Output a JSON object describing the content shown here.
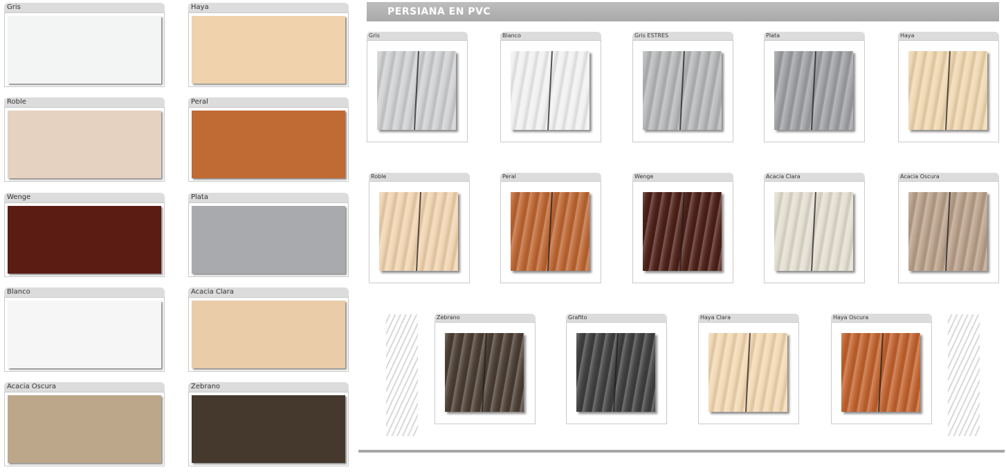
{
  "left_swatches": [
    {
      "label": "Gris",
      "color": "#f3f4f4"
    },
    {
      "label": "Haya",
      "color": "#f0d2ad"
    },
    {
      "label": "Roble",
      "color": "#e5d2c0"
    },
    {
      "label": "Peral",
      "color": "#c06a34"
    },
    {
      "label": "Wenge",
      "color": "#5b1c14"
    },
    {
      "label": "Plata",
      "color": "#a8aaad"
    },
    {
      "label": "Blanco",
      "color": "#f6f6f6"
    },
    {
      "label": "Acacia Clara",
      "color": "#ebcca9"
    },
    {
      "label": "Acacia Oscura",
      "color": "#bda78b"
    },
    {
      "label": "Zebrano",
      "color": "#45392d"
    }
  ],
  "pvc": {
    "title": "PERSIANA EN PVC",
    "swatches": [
      {
        "label": "Gris",
        "color": "#cfd0d2"
      },
      {
        "label": "Blanco",
        "color": "#f1f1f1"
      },
      {
        "label": "Gris ESTRES",
        "color": "#b6b7b8"
      },
      {
        "label": "Plata",
        "color": "#9ea0a3"
      },
      {
        "label": "Haya",
        "color": "#f0d7b0"
      },
      {
        "label": "Roble",
        "color": "#f1d4b0"
      },
      {
        "label": "Peral",
        "color": "#bd6632"
      },
      {
        "label": "Wenge",
        "color": "#4c1f16"
      },
      {
        "label": "Acacia Clara",
        "color": "#e3ded0"
      },
      {
        "label": "Acacia Oscura",
        "color": "#b9a08a"
      },
      {
        "label": "Zebrano",
        "color": "#4a3d33"
      },
      {
        "label": "Grafito",
        "color": "#3f3f40"
      },
      {
        "label": "Haya Clara",
        "color": "#f3d8b2"
      },
      {
        "label": "Haya Oscura",
        "color": "#c1622e"
      }
    ]
  }
}
